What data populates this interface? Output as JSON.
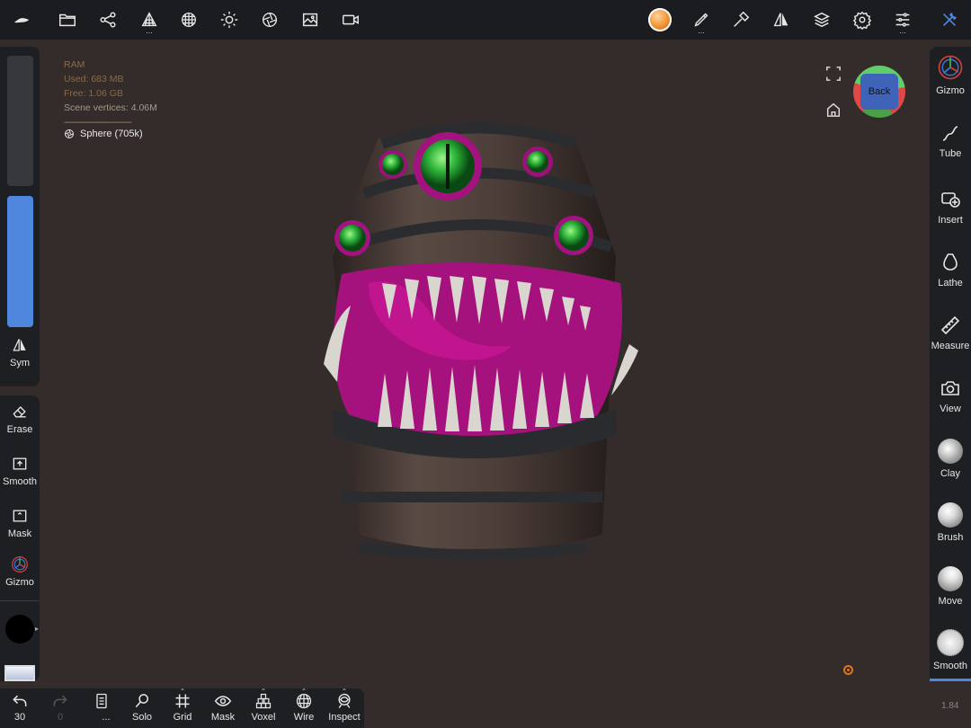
{
  "topbar": {
    "icons": [
      "logo-icon",
      "folder-icon",
      "scene-graph-icon",
      "topology-icon",
      "shading-icon",
      "light-icon",
      "camera-icon",
      "background-image-icon",
      "video-icon",
      "material-sphere-icon",
      "paint-icon",
      "hammer-icon",
      "symmetry-icon",
      "layers-icon",
      "settings-icon",
      "sliders-icon",
      "tools-icon"
    ],
    "dots": "..."
  },
  "left_panel": {
    "sym_label": "Sym",
    "erase_label": "Erase",
    "smooth_label": "Smooth",
    "mask_label": "Mask",
    "gizmo_label": "Gizmo",
    "slider_fill_color": "#4f86de"
  },
  "right_panel": {
    "items": [
      {
        "label": "Gizmo",
        "icon": "gizmo-icon"
      },
      {
        "label": "Tube",
        "icon": "tube-icon"
      },
      {
        "label": "Insert",
        "icon": "insert-icon"
      },
      {
        "label": "Lathe",
        "icon": "lathe-icon"
      },
      {
        "label": "Measure",
        "icon": "ruler-icon"
      },
      {
        "label": "View",
        "icon": "camera-icon"
      },
      {
        "label": "Clay",
        "icon": "clay-sphere-icon"
      },
      {
        "label": "Brush",
        "icon": "brush-sphere-icon"
      },
      {
        "label": "Move",
        "icon": "move-sphere-icon"
      },
      {
        "label": "Smooth",
        "icon": "smooth-sphere-icon"
      }
    ],
    "selected_label": "Smooth"
  },
  "stats": {
    "ram_label": "RAM",
    "used": "Used:  683 MB",
    "free": "Free:  1.06 GB",
    "vertices": "Scene vertices:  4.06M",
    "separator": "------------------------------"
  },
  "mesh": {
    "name": "Sphere (705k)"
  },
  "gizmo_cube": {
    "face_label": "Back"
  },
  "bottombar": {
    "undo_count": "30",
    "redo_count": "0",
    "more_label": "...",
    "solo_label": "Solo",
    "grid_label": "Grid",
    "mask_label": "Mask",
    "voxel_label": "Voxel",
    "wire_label": "Wire",
    "inspect_label": "Inspect"
  },
  "version": "1.84",
  "colors": {
    "accent": "#4f86de",
    "pivot": "#e0761a",
    "background": "#332c2a"
  }
}
